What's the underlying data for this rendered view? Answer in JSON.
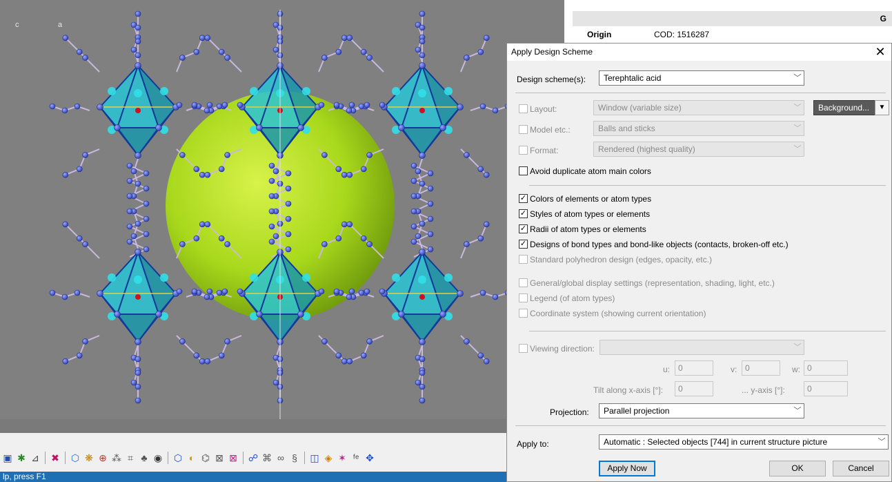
{
  "viewer": {
    "axis_c": "c",
    "axis_a": "a"
  },
  "info": {
    "header_letter": "G",
    "origin_label": "Origin",
    "origin_value": "COD: 1516287"
  },
  "statusbar": {
    "text": "lp, press F1"
  },
  "dialog": {
    "title": "Apply Design Scheme",
    "close_glyph": "✕",
    "design_scheme_label": "Design scheme(s):",
    "design_scheme_value": "Terephtalic acid",
    "layout": {
      "label": "Layout:",
      "value": "Window (variable size)",
      "checked": false
    },
    "background_button": "Background...",
    "model": {
      "label": "Model etc.:",
      "value": "Balls and sticks",
      "checked": false
    },
    "format": {
      "label": "Format:",
      "value": "Rendered (highest quality)",
      "checked": false
    },
    "avoid_duplicate": {
      "label": "Avoid duplicate atom main colors",
      "checked": false
    },
    "options": [
      {
        "label": "Colors of elements or atom types",
        "checked": true,
        "enabled": true
      },
      {
        "label": "Styles of atom types or elements",
        "checked": true,
        "enabled": true
      },
      {
        "label": "Radii of atom types or elements",
        "checked": true,
        "enabled": true
      },
      {
        "label": "Designs of bond types and bond-like objects (contacts, broken-off etc.)",
        "checked": true,
        "enabled": true
      },
      {
        "label": "Standard polyhedron design (edges, opacity, etc.)",
        "checked": false,
        "enabled": false
      },
      {
        "label": "General/global display settings (representation, shading, light, etc.)",
        "checked": false,
        "enabled": false
      },
      {
        "label": "Legend (of atom types)",
        "checked": false,
        "enabled": false
      },
      {
        "label": "Coordinate system (showing current orientation)",
        "checked": false,
        "enabled": false
      }
    ],
    "viewing_direction": {
      "label": "Viewing direction:",
      "value": "",
      "checked": false
    },
    "u_label": "u:",
    "u_value": "0",
    "v_label": "v:",
    "v_value": "0",
    "w_label": "w:",
    "w_value": "0",
    "tilt_x_label": "Tilt along x-axis [°]:",
    "tilt_x_value": "0",
    "tilt_y_label": "... y-axis [°]:",
    "tilt_y_value": "0",
    "projection_label": "Projection:",
    "projection_value": "Parallel projection",
    "apply_to_label": "Apply to:",
    "apply_to_value": "Automatic : Selected objects [744] in current structure picture",
    "apply_now": "Apply Now",
    "ok": "OK",
    "cancel": "Cancel"
  },
  "colors": {
    "viewer_bg": "#808080",
    "sphere": "#a8d81c",
    "polyhedron": "#1fb0c0",
    "atom": "#3a52d6",
    "accent": "#0078d7"
  }
}
